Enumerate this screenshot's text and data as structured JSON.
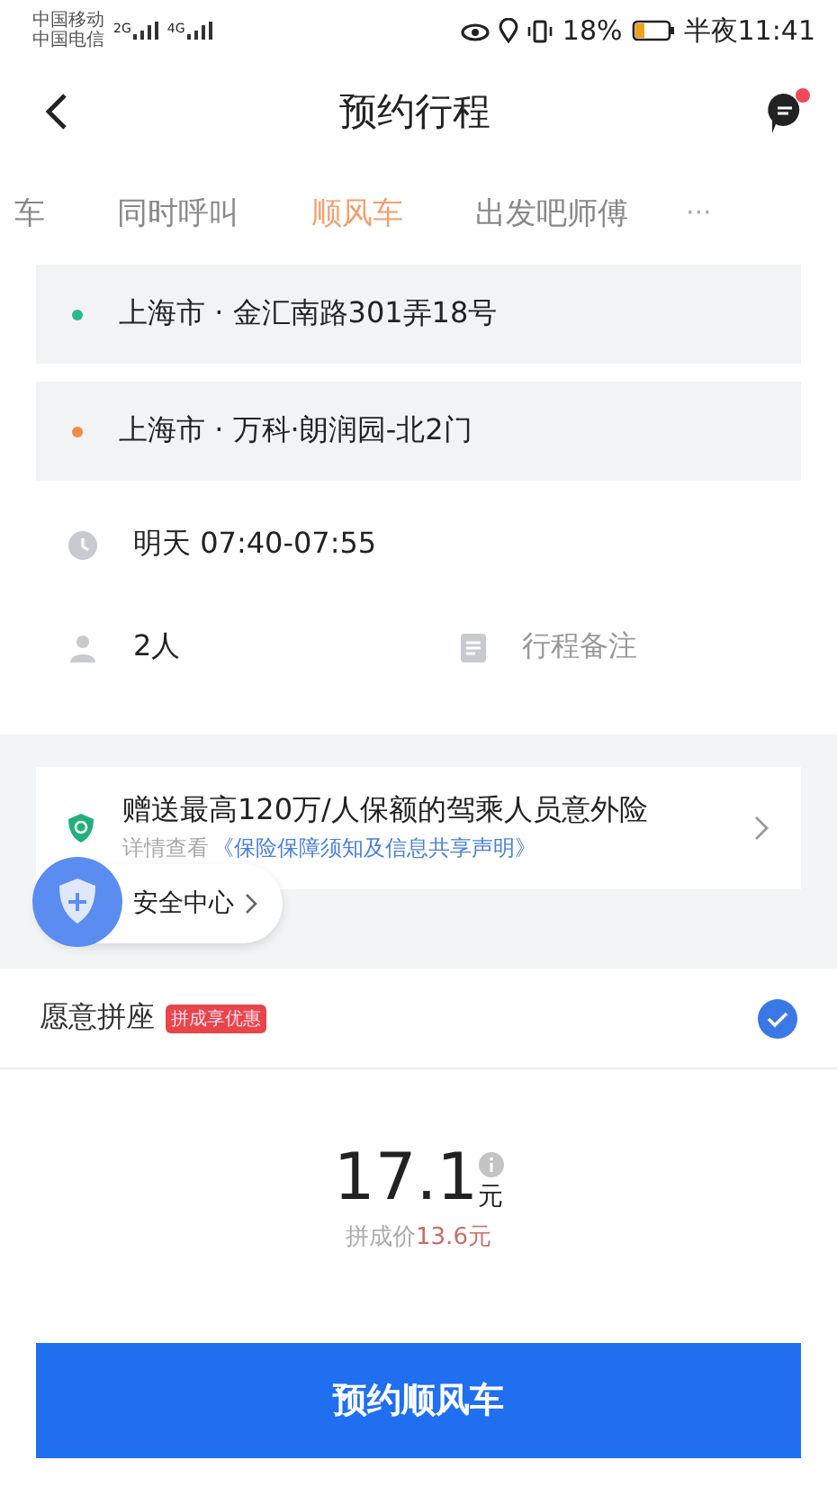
{
  "status_bar": {
    "carriers": [
      "中国移动",
      "中国电信"
    ],
    "networks": [
      "2G",
      "4G"
    ],
    "battery_percent": "18%",
    "time": "半夜11:41"
  },
  "header": {
    "title": "预约行程",
    "has_unread": true
  },
  "tabs": [
    {
      "label": "车",
      "selected": false
    },
    {
      "label": "同时呼叫",
      "selected": false
    },
    {
      "label": "顺风车",
      "selected": true
    },
    {
      "label": "出发吧师傅",
      "selected": false
    }
  ],
  "more": "···",
  "route": [
    {
      "address": "上海市 · 金汇南路301弄18号",
      "color": "#2eb88a"
    },
    {
      "address": "上海市 · 万科·朗润园-北2门",
      "color": "#f08a4b"
    }
  ],
  "time": "明天 07:40-07:55",
  "passengers": "2人",
  "note": {
    "placeholder": "行程备注"
  },
  "insurance": {
    "title": "赠送最高120万/人保额的驾乘人员意外险",
    "prefix": "详情查看",
    "link": "《保险保障须知及信息共享声明》"
  },
  "safety_center": "安全中心",
  "carpool": {
    "label": "愿意拼座",
    "tag": "拼成享优惠",
    "checked": true
  },
  "price": {
    "amount": "17.1",
    "unit": "元",
    "pooled_label": "拼成价",
    "pooled_price": "13.6元"
  },
  "submit": "预约顺风车"
}
